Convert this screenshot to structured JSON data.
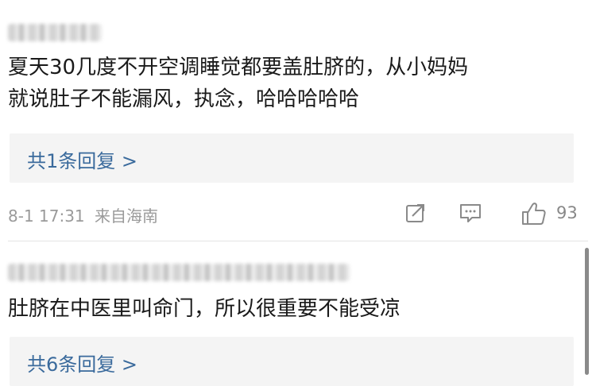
{
  "comments": [
    {
      "body": [
        "夏天30几度不开空调睡觉都要盖肚脐的，从小妈妈",
        "就说肚子不能漏风，执念，哈哈哈哈哈"
      ],
      "reply_label": "共1条回复 >",
      "timestamp": "8-1 17:31",
      "location": "来自海南",
      "like_count": "93"
    },
    {
      "body": [
        "肚脐在中医里叫命门，所以很重要不能受凉"
      ],
      "reply_label": "共6条回复 >"
    }
  ],
  "colors": {
    "link": "#3a6a9c",
    "meta": "#9a9a9a",
    "reply_bg": "#f4f4f4"
  },
  "icons": [
    "share-icon",
    "comment-icon",
    "like-icon"
  ]
}
